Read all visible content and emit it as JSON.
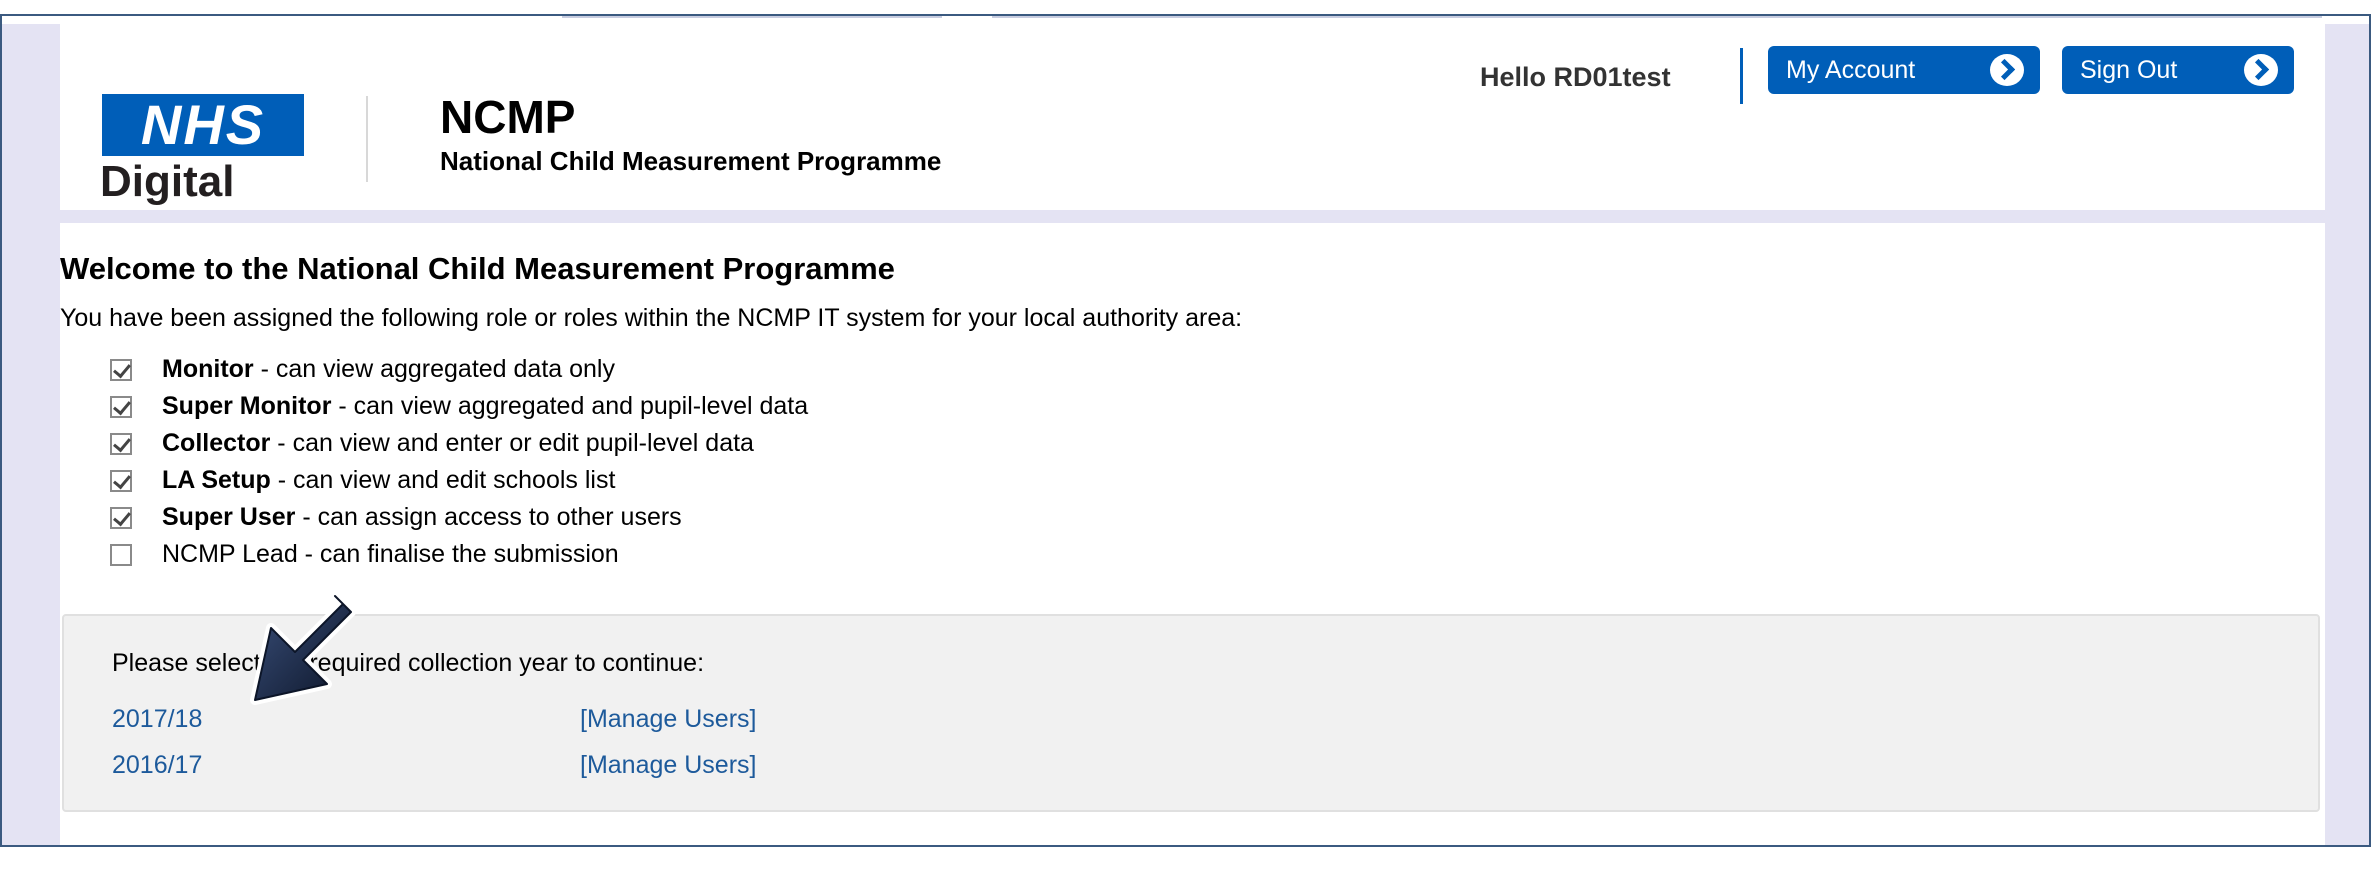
{
  "header": {
    "logo_text": "NHS",
    "logo_sub": "Digital",
    "app_title": "NCMP",
    "app_subtitle": "National Child Measurement Programme",
    "greeting": "Hello RD01test",
    "my_account_label": "My Account",
    "sign_out_label": "Sign Out"
  },
  "main": {
    "welcome_title": "Welcome to the National Child Measurement Programme",
    "intro_text": "You have been assigned the following role or roles within the NCMP IT system for your local authority area:",
    "roles": [
      {
        "name": "Monitor",
        "desc": " - can view aggregated data only",
        "checked": true
      },
      {
        "name": "Super Monitor",
        "desc": " - can view aggregated and pupil-level data",
        "checked": true
      },
      {
        "name": "Collector",
        "desc": " - can view and enter or edit pupil-level data",
        "checked": true
      },
      {
        "name": "LA Setup",
        "desc": " - can view and edit schools list",
        "checked": true
      },
      {
        "name": "Super User",
        "desc": " - can assign access to other users",
        "checked": true
      },
      {
        "name": "NCMP Lead",
        "desc": " - can finalise the submission",
        "checked": false
      }
    ],
    "prompt": "Please select the required collection year to continue:",
    "years": [
      {
        "year": "2017/18",
        "manage": "[Manage Users]"
      },
      {
        "year": "2016/17",
        "manage": "[Manage Users]"
      }
    ]
  },
  "icons": {
    "annotation": "arrow-down-left-icon",
    "button_chevron": "chevron-right-icon"
  },
  "colors": {
    "nhs_blue": "#005eb8",
    "link_blue": "#1d5a9b",
    "page_lavender": "#e4e3f3",
    "annotation_arrow": "#14203a"
  }
}
